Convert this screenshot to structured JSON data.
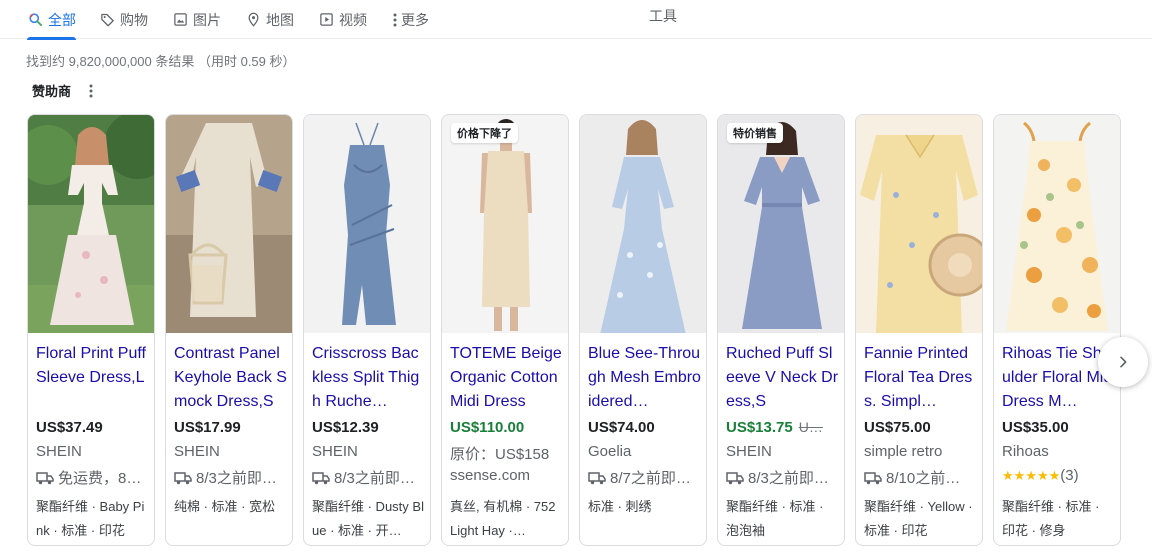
{
  "tabs": [
    {
      "label": "全部",
      "icon": "search-icon",
      "active": true
    },
    {
      "label": "购物",
      "icon": "tag-icon"
    },
    {
      "label": "图片",
      "icon": "image-icon"
    },
    {
      "label": "地图",
      "icon": "map-pin-icon"
    },
    {
      "label": "视频",
      "icon": "play-icon"
    },
    {
      "label": "更多",
      "icon": "more-vert-icon"
    }
  ],
  "tools_label": "工具",
  "result_stats": "找到约 9,820,000,000 条结果 （用时 0.59 秒）",
  "sponsored_label": "赞助商",
  "colors": {
    "link": "#1a0dab",
    "accent": "#1a73e8",
    "sale": "#188038",
    "star": "#fbbc04"
  },
  "products": [
    {
      "title": "Floral Print Puff Sleeve Dress,L",
      "price": "US$37.49",
      "store": "SHEIN",
      "shipping": "免运费，8…",
      "attrs": "聚酯纤维 · Baby Pink · 标准 · 印花"
    },
    {
      "title": "Contrast Panel Keyhole Back Smock Dress,S",
      "price": "US$17.99",
      "store": "SHEIN",
      "shipping": "8/3之前即…",
      "attrs": "纯棉 · 标准 · 宽松"
    },
    {
      "title": "Crisscross Backless Split Thigh Ruche…",
      "price": "US$12.39",
      "store": "SHEIN",
      "shipping": "8/3之前即…",
      "attrs": "聚酯纤维 · Dusty Blue · 标准 · 开…"
    },
    {
      "badge": "价格下降了",
      "title": "TOTEME Beige Organic Cotton Midi Dress",
      "price": "US$110.00",
      "price_sale": true,
      "original_price_line": "原价：US$158",
      "store": "ssense.com",
      "attrs": "真丝, 有机棉 · 752 Light Hay ·…"
    },
    {
      "title": "Blue See-Through Mesh Embroidered…",
      "price": "US$74.00",
      "store": "Goelia",
      "shipping": "8/7之前即…",
      "attrs": "标准 · 刺绣"
    },
    {
      "badge": "特价销售",
      "title": "Ruched Puff Sleeve V Neck Dress,S",
      "price": "US$13.75",
      "price_sale": true,
      "price_orig": "U…",
      "store": "SHEIN",
      "shipping": "8/3之前即…",
      "attrs": "聚酯纤维 · 标准 · 泡泡袖"
    },
    {
      "title": "Fannie Printed Floral Tea Dress. Simpl…",
      "price": "US$75.00",
      "store": "simple retro",
      "shipping": "8/10之前…",
      "attrs": "聚酯纤维 · Yellow · 标准 · 印花"
    },
    {
      "title": "Rihoas Tie Shoulder Floral Midi Dress M…",
      "price": "US$35.00",
      "store": "Rihoas",
      "rating_stars": "★★★★★",
      "rating_count": "(3)",
      "attrs": "聚酯纤维 · 标准 · 印花 · 修身"
    }
  ]
}
